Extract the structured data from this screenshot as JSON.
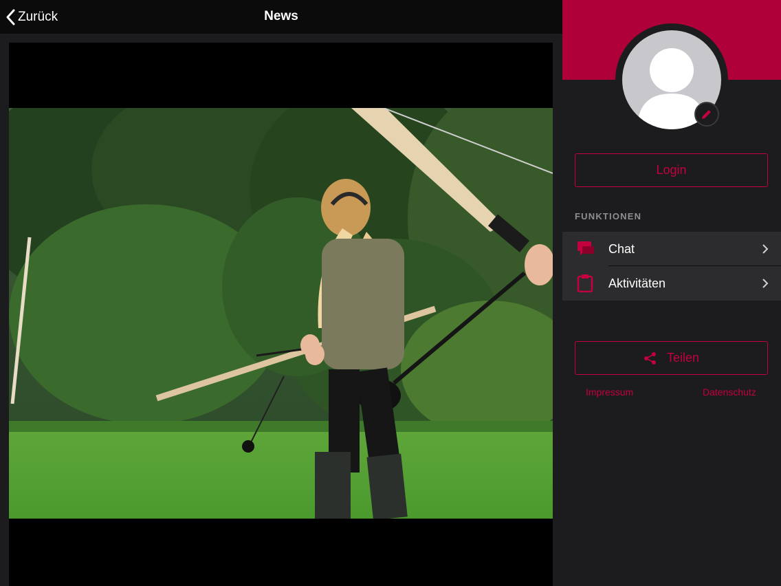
{
  "navbar": {
    "back_label": "Zurück",
    "title": "News"
  },
  "sidebar": {
    "login_label": "Login",
    "section_label": "FUNKTIONEN",
    "items": [
      {
        "label": "Chat",
        "icon": "chat-icon"
      },
      {
        "label": "Aktivitäten",
        "icon": "clipboard-icon"
      }
    ],
    "share_label": "Teilen",
    "impressum_label": "Impressum",
    "datenschutz_label": "Datenschutz"
  },
  "colors": {
    "accent": "#c4003f",
    "banner": "#b0003a",
    "background": "#1c1c1e",
    "navbar": "#0b0b0b"
  }
}
